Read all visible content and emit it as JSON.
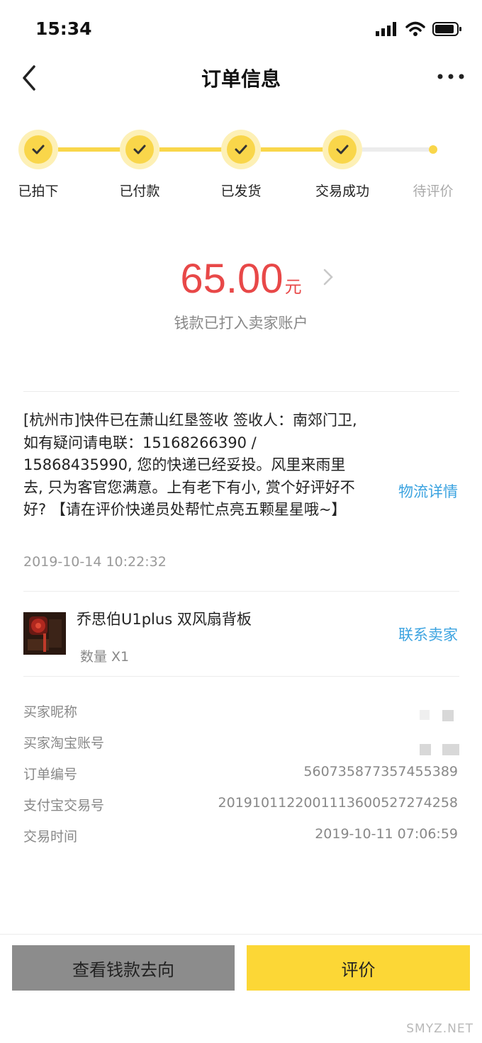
{
  "status_bar": {
    "time": "15:34"
  },
  "nav": {
    "title": "订单信息",
    "back_icon": "chevron-left-icon",
    "more_icon": "more-dots-icon"
  },
  "progress": {
    "steps": [
      {
        "label": "已拍下",
        "done": true
      },
      {
        "label": "已付款",
        "done": true
      },
      {
        "label": "已发货",
        "done": true
      },
      {
        "label": "交易成功",
        "done": true
      },
      {
        "label": "待评价",
        "done": false
      }
    ],
    "accent": "#f9d64a"
  },
  "amount": {
    "value": "65.00",
    "unit": "元",
    "note": "钱款已打入卖家账户",
    "color": "#e84848"
  },
  "logistics": {
    "text": "[杭州市]快件已在萧山红垦签收 签收人：南郊门卫,如有疑问请电联：15168266390 / 15868435990, 您的快递已经妥投。风里来雨里去, 只为客官您满意。上有老下有小, 赏个好评好不好? 【请在评价快递员处帮忙点亮五颗星星哦~】",
    "time": "2019-10-14 10:22:32",
    "link": "物流详情"
  },
  "product": {
    "name": "乔思伯U1plus 双风扇背板",
    "quantity": "数量 X1",
    "contact": "联系卖家"
  },
  "info": [
    {
      "label": "买家昵称",
      "value": ""
    },
    {
      "label": "买家淘宝账号",
      "value": ""
    },
    {
      "label": "订单编号",
      "value": "560735877357455389"
    },
    {
      "label": "支付宝交易号",
      "value": "2019101122001113600527274258"
    },
    {
      "label": "交易时间",
      "value": "2019-10-11 07:06:59"
    }
  ],
  "buttons": {
    "money_flow": "查看钱款去向",
    "review": "评价"
  },
  "watermark": "SMYZ.NET"
}
